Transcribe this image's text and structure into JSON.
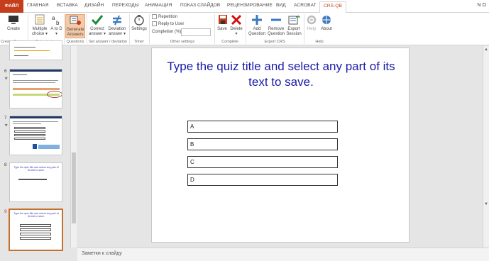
{
  "tabs": [
    "ФАЙЛ",
    "ГЛАВНАЯ",
    "ВСТАВКА",
    "ДИЗАЙН",
    "ПЕРЕХОДЫ",
    "АНИМАЦИЯ",
    "ПОКАЗ СЛАЙДОВ",
    "РЕЦЕНЗИРОВАНИЕ",
    "ВИД",
    "ACROBAT",
    "CRS-QB"
  ],
  "active_tab": "CRS-QB",
  "user_initials": "N O",
  "ribbon": {
    "create": "Create",
    "multiple_choice": "Multiple choice",
    "a_to_d": "A to D",
    "generate_answers": "Generate Answers",
    "correct_answer": "Correct answer",
    "deviation_answer": "Deviation answer",
    "settings": "Settings",
    "repetition": "Repetition",
    "reply_to_user": "Reply to User",
    "completion": "Completion (%)",
    "save": "Save",
    "delete": "Delete",
    "add_question": "Add Question",
    "remove_question": "Remove Question",
    "export_session": "Export Session",
    "help": "Help",
    "about": "About",
    "groups": {
      "create_session": "Create Session",
      "set_quiz_type": "Set quiz type",
      "questions": "Questions",
      "set_answer": "Set answer / deviation",
      "timer": "Timer",
      "other_settings": "Other settings",
      "complete": "Complete",
      "export_crs": "Export CRS",
      "help": "Help"
    }
  },
  "thumbnails": [
    {
      "num": "6",
      "star": "★"
    },
    {
      "num": "7",
      "star": "★"
    },
    {
      "num": "8",
      "text": "Type the quiz title and select any part of its text to save."
    },
    {
      "num": "9",
      "text": "Type the quiz title and select any part of its text to save."
    }
  ],
  "slide": {
    "title": "Type the quiz title and select any part of its text to save.",
    "answers": [
      "A",
      "B",
      "C",
      "D"
    ]
  },
  "notes_label": "Заметки к слайду",
  "colors": {
    "accent": "#c43e1c",
    "title_blue": "#1a1aa6",
    "selected_button": "#f6c9a6"
  }
}
